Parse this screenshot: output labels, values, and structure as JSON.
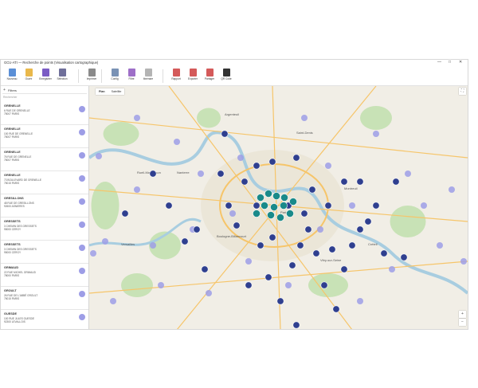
{
  "window": {
    "title": "GCU-ATI — Recherche de points (Visualisation cartographique)",
    "minimize_glyph": "—",
    "maximize_glyph": "□",
    "close_glyph": "✕"
  },
  "ribbon": {
    "buttons": [
      {
        "label": "Nouveau",
        "icon": "new-document-icon",
        "color": "#5b8fd6"
      },
      {
        "label": "Ouvrir",
        "icon": "open-folder-icon",
        "color": "#e9b84b"
      },
      {
        "label": "Enregistrer",
        "icon": "save-icon",
        "color": "#7b5cc4"
      },
      {
        "label": "Sélection",
        "icon": "select-icon",
        "color": "#6f6f9a"
      },
      {
        "label": "Imprimer",
        "icon": "print-icon",
        "color": "#8a8a8a"
      },
      {
        "label": "Config",
        "icon": "gear-icon",
        "color": "#7a92b5"
      },
      {
        "label": "Filtre",
        "icon": "filter-icon",
        "color": "#9e6fc8"
      },
      {
        "label": "Itinéraire",
        "icon": "route-icon",
        "color": "#b4b4b4"
      },
      {
        "label": "Rapport",
        "icon": "report-icon",
        "color": "#d45a5a"
      },
      {
        "label": "Exporter",
        "icon": "export-icon",
        "color": "#d45a5a"
      },
      {
        "label": "Partager",
        "icon": "share-icon",
        "color": "#d45a5a"
      },
      {
        "label": "QR Code",
        "icon": "qr-code-icon",
        "color": "#333333"
      }
    ]
  },
  "sidebar": {
    "filter_label": "Filtres",
    "search_placeholder": "Rechercher",
    "items": [
      {
        "name": "GRENELLE",
        "addr1": "6 RUE DE GRENELLE",
        "addr2": "75007 PARIS"
      },
      {
        "name": "GRENELLE",
        "addr1": "100 RUE DE GRENELLE",
        "addr2": "75007 PARIS"
      },
      {
        "name": "GRENELLE",
        "addr1": "76 RUE DE GRENELLE",
        "addr2": "75007 PARIS"
      },
      {
        "name": "GRENELLE",
        "addr1": "73 BOULEVARD DE GRENELLE",
        "addr2": "75015 PARIS"
      },
      {
        "name": "GRESILLONS",
        "addr1": "48 RUE DE GRESILLONS",
        "addr2": "92600 ASNIERES"
      },
      {
        "name": "GRESSETS",
        "addr1": "3 CHEMIN DES GRESSETS",
        "addr2": "95000 CERGY"
      },
      {
        "name": "GRESSETS",
        "addr1": "3 CHEMIN DES GRESSETS",
        "addr2": "95000 CERGY"
      },
      {
        "name": "GRIMAUD",
        "addr1": "22 RUE MICHEL GRIMAUD",
        "addr2": "78000 PARIS"
      },
      {
        "name": "GROULT",
        "addr1": "26 RUE DE L'ABBÉ GROULT",
        "addr2": "75015 PARIS"
      },
      {
        "name": "GUESDE",
        "addr1": "100 RUE JULES GUESDE",
        "addr2": "92300 LEVALLOIS"
      }
    ]
  },
  "map": {
    "tab_plan": "Plan",
    "tab_satellite": "Satellite",
    "zoom_in": "+",
    "zoom_out": "−",
    "fullscreen_glyph": "⛶",
    "place_labels": [
      "Argenteuil",
      "Nanterre",
      "Paris",
      "Saint-Denis",
      "Montreuil",
      "Boulogne-Billancourt",
      "Versailles",
      "Vitry-sur-Seine",
      "Créteil",
      "Rueil-Malmaison"
    ],
    "colors": {
      "cluster_dark": "#2f3f8f",
      "cluster_teal": "#1a8a8a",
      "point_light": "#9d9de6",
      "water": "#a8cde0",
      "park": "#c8e2b6",
      "urban": "#f1eee6",
      "road": "#f6c56a"
    }
  }
}
